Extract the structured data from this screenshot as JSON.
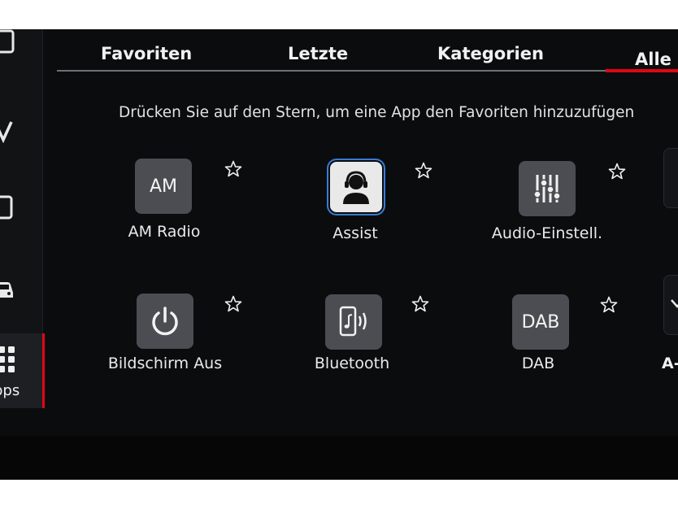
{
  "tabs": {
    "favoriten": "Favoriten",
    "letzte": "Letzte",
    "kategorien": "Kategorien",
    "alle": "Alle"
  },
  "hint": "Drücken Sie auf den Stern, um eine App den Favoriten hinzuzufügen",
  "sidebar": {
    "apps_label": "pps"
  },
  "apps": {
    "am_radio": {
      "icon_text": "AM",
      "label": "AM Radio",
      "icon": "am-icon"
    },
    "assist": {
      "label": "Assist",
      "icon": "headset-person-icon"
    },
    "audio": {
      "label": "Audio-Einstell.",
      "icon": "equalizer-sliders-icon"
    },
    "screen_off": {
      "label": "Bildschirm Aus",
      "icon": "power-icon"
    },
    "bluetooth": {
      "label": "Bluetooth",
      "icon": "phone-sound-icon"
    },
    "dab": {
      "icon_text": "DAB",
      "label": "DAB",
      "icon": "dab-icon"
    }
  },
  "edge": {
    "label": "A-"
  },
  "colors": {
    "accent": "#e30613",
    "background": "#0b0c0e",
    "tile": "#4b4d52",
    "selected_outline": "#3a7bd5"
  }
}
